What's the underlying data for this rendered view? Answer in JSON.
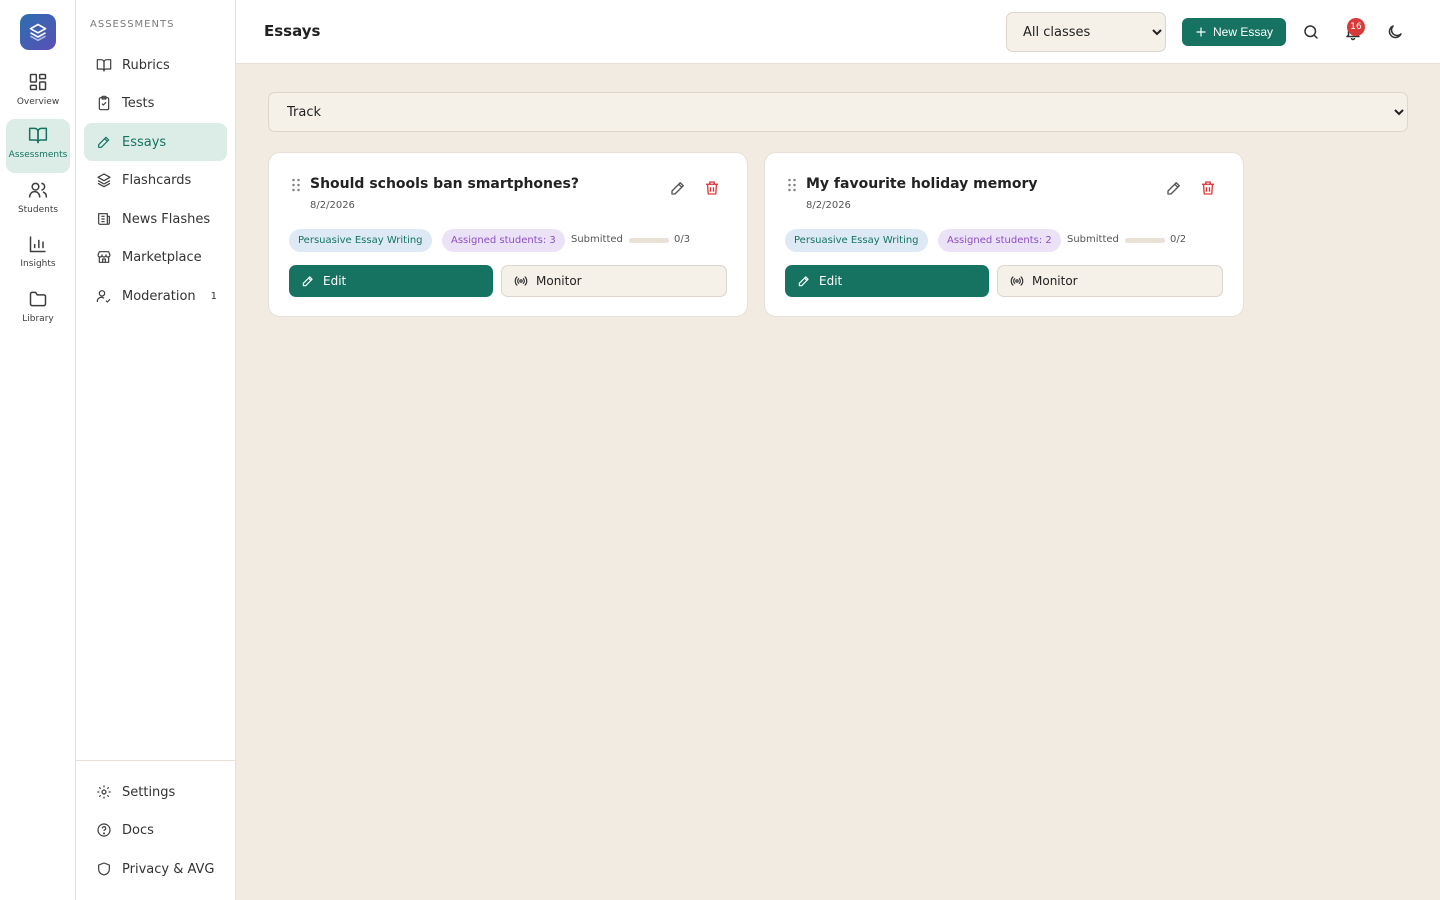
{
  "rail": {
    "items": [
      {
        "label": "Overview",
        "icon": "grid-icon"
      },
      {
        "label": "Assessments",
        "icon": "book-open-icon"
      },
      {
        "label": "Students",
        "icon": "users-icon"
      },
      {
        "label": "Insights",
        "icon": "bar-chart-icon"
      },
      {
        "label": "Library",
        "icon": "folder-icon"
      }
    ],
    "active": "Assessments"
  },
  "sidebar": {
    "heading": "ASSESSMENTS",
    "items": [
      {
        "label": "Rubrics",
        "icon": "book-icon"
      },
      {
        "label": "Tests",
        "icon": "clipboard-check-icon"
      },
      {
        "label": "Essays",
        "icon": "pencil-icon"
      },
      {
        "label": "Flashcards",
        "icon": "layers-icon"
      },
      {
        "label": "News Flashes",
        "icon": "newspaper-icon"
      },
      {
        "label": "Marketplace",
        "icon": "store-icon"
      },
      {
        "label": "Moderation",
        "icon": "user-check-icon",
        "badge": "1"
      }
    ],
    "active": "Essays",
    "footer": [
      {
        "label": "Settings",
        "icon": "gear-icon"
      },
      {
        "label": "Docs",
        "icon": "help-circle-icon"
      },
      {
        "label": "Privacy & AVG",
        "icon": "shield-icon"
      }
    ]
  },
  "header": {
    "title": "Essays",
    "class_filter": "All classes",
    "new_button": "New Essay",
    "notification_count": "16"
  },
  "filter": {
    "track": "Track"
  },
  "essays": [
    {
      "title": "Should schools ban smartphones?",
      "date": "8/2/2026",
      "topic": "Persuasive Essay Writing",
      "assigned": "Assigned students: 3",
      "submitted_label": "Submitted",
      "submitted": "0/3",
      "progress": 0,
      "edit": "Edit",
      "monitor": "Monitor"
    },
    {
      "title": "My favourite holiday memory",
      "date": "8/2/2026",
      "topic": "Persuasive Essay Writing",
      "assigned": "Assigned students: 2",
      "submitted_label": "Submitted",
      "submitted": "0/2",
      "progress": 0,
      "edit": "Edit",
      "monitor": "Monitor"
    }
  ],
  "colors": {
    "accent": "#167362",
    "background": "#f1ebe1",
    "active_bg": "#dcece6",
    "danger": "#d83a3a",
    "assigned_chip": "#8a4fc7"
  }
}
